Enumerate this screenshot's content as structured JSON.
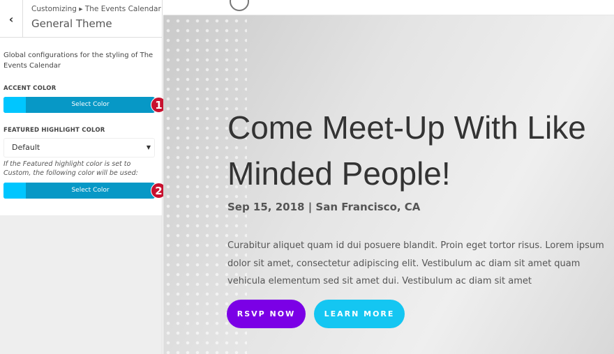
{
  "sidebar": {
    "breadcrumb": "Customizing ▸ The Events Calendar",
    "title": "General Theme",
    "description": "Global configurations for the styling of The Events Calendar",
    "accent_label": "ACCENT COLOR",
    "accent_button": "Select Color",
    "accent_badge": "1",
    "featured_label": "FEATURED HIGHLIGHT COLOR",
    "featured_select": "Default",
    "featured_hint": "If the Featured highlight color is set to Custom, the following color will be used:",
    "featured_button": "Select Color",
    "featured_badge": "2",
    "swatch_color": "#00c6ff",
    "button_color": "#0798c6"
  },
  "preview": {
    "heading": "Come Meet-Up With Like Minded People!",
    "date": "Sep 15, 2018 | San Francisco, CA",
    "body": "Curabitur aliquet quam id dui posuere blandit. Proin eget tortor risus. Lorem ipsum dolor sit amet, consectetur adipiscing elit. Vestibulum ac diam sit amet quam vehicula elementum sed sit amet dui. Vestibulum ac diam sit amet",
    "rsvp_button": "RSVP NOW",
    "learn_button": "LEARN MORE",
    "rsvp_color": "#7b00e6",
    "learn_color": "#14c6f2"
  }
}
